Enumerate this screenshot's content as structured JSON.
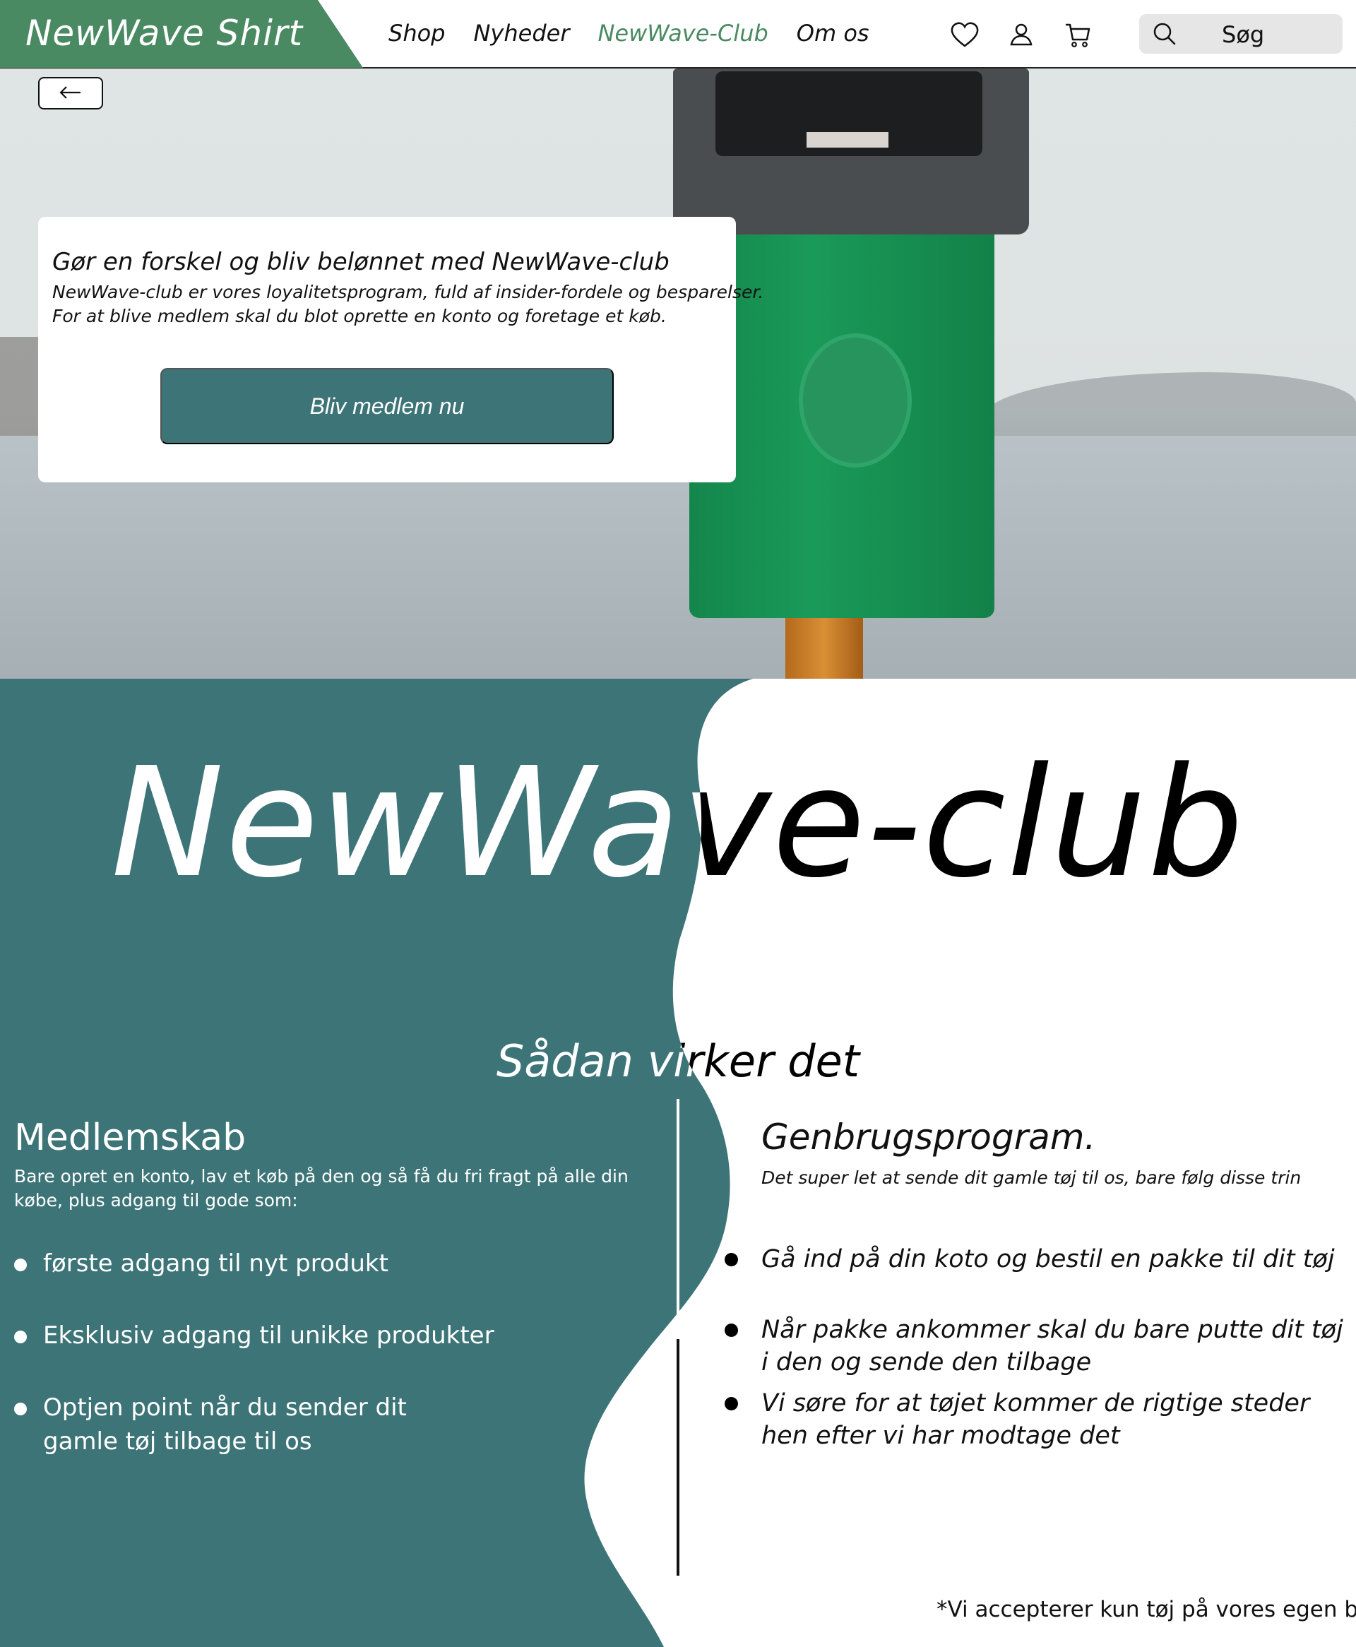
{
  "header": {
    "brand": "NewWave Shirt",
    "nav": [
      "Shop",
      "Nyheder",
      "NewWave-Club",
      "Om os"
    ],
    "active_nav": "NewWave-Club",
    "icons": [
      "heart-icon",
      "user-icon",
      "cart-icon",
      "search-icon"
    ],
    "search_label": "Søg"
  },
  "hero": {
    "back_icon": "arrow-left-icon",
    "promo_title": "Gør en forskel og bliv belønnet med NewWave-club",
    "promo_text_1": "NewWave-club er vores loyalitetsprogram, fuld af insider-fordele og besparelser.",
    "promo_text_2": "For at blive medlem skal du blot oprette en konto og foretage et køb.",
    "promo_button": "Bliv medlem nu"
  },
  "club": {
    "title": "NewWave-club",
    "how_title": "Sådan virker det",
    "membership": {
      "heading": "Medlemskab",
      "lead": "Bare opret en konto, lav et køb på den og så få du fri fragt på alle din købe, plus adgang til gode som:",
      "items": [
        "første adgang til nyt produkt",
        "Eksklusiv adgang til unikke produkter",
        "Optjen point når du sender dit gamle tøj tilbage til os"
      ]
    },
    "recycling": {
      "heading": "Genbrugsprogram.",
      "lead": "Det super let at sende dit gamle tøj til os, bare følg disse trin",
      "items": [
        "Gå ind på din koto og bestil en pakke til dit tøj",
        "Når pakke ankommer skal du bare putte dit tøj i den og sende den tilbage",
        "Vi søre for at tøjet kommer de rigtige steder hen efter vi har modtage det"
      ]
    },
    "footnote": "*Vi accepterer kun tøj på vores egen butik"
  },
  "colors": {
    "brand_green": "#4a8a62",
    "teal": "#3d7477",
    "bin_green": "#1a9a58"
  }
}
